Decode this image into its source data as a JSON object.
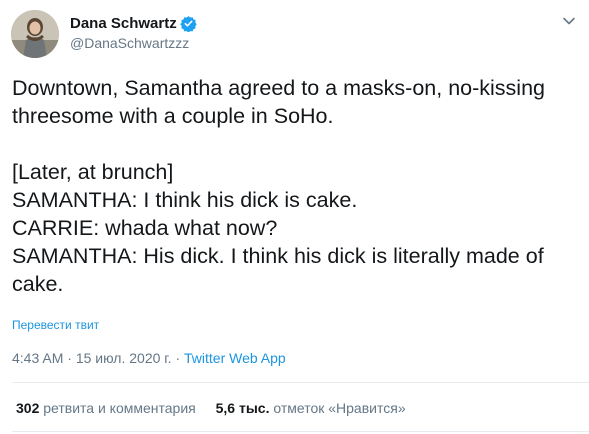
{
  "author": {
    "display_name": "Dana Schwartz",
    "handle": "@DanaSchwartzzz",
    "verified": true
  },
  "tweet": {
    "lines_paragraph_1": [
      "Downtown, Samantha agreed to a masks-on, no-kissing",
      "threesome with a couple in SoHo."
    ],
    "lines_paragraph_2": [
      "[Later, at brunch]",
      "SAMANTHA: I think his dick is cake.",
      "CARRIE: whada what now?",
      "SAMANTHA: His dick. I think his dick is literally made of",
      "cake."
    ]
  },
  "translate_label": "Перевести твит",
  "meta": {
    "time": "4:43 AM",
    "separator": " · ",
    "date": "15 июл. 2020 г.",
    "source": "Twitter Web App"
  },
  "stats": {
    "retweets_count": "302",
    "retweets_label": "ретвита и комментария",
    "likes_count": "5,6 тыс.",
    "likes_label": "отметок «Нравится»"
  },
  "colors": {
    "text": "#14171a",
    "secondary": "#657786",
    "link": "#1b95e0",
    "divider": "#e6ecf0",
    "verified": "#1da1f2"
  },
  "icons": {
    "verified": "verified-badge-icon",
    "caret": "chevron-down-icon"
  }
}
